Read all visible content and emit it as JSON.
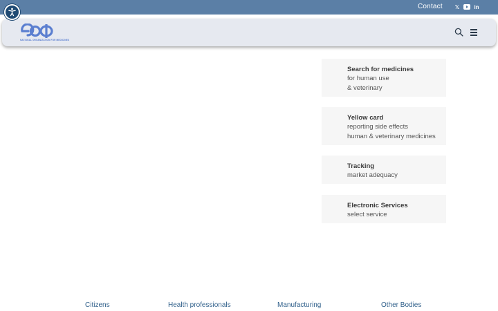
{
  "topbar": {
    "contact_label": "Contact",
    "social": [
      {
        "icon": "x-icon",
        "glyph": "𝕏"
      },
      {
        "icon": "youtube-icon",
        "glyph": "▶"
      },
      {
        "icon": "linkedin-icon",
        "glyph": "in"
      }
    ]
  },
  "accessibility": {
    "icon": "accessibility-icon"
  },
  "header": {
    "logo_text": "EOФ",
    "logo_subtitle": "NATIONAL ORGANIZATION FOR MEDICINES",
    "search_icon": "search-icon",
    "menu_icon": "hamburger-menu-icon"
  },
  "cards": [
    {
      "title": "Search for medicines",
      "lines": [
        "for human use",
        "& veterinary"
      ]
    },
    {
      "title": "Yellow card",
      "lines": [
        "reporting side effects",
        "human & veterinary medicines"
      ]
    },
    {
      "title": "Tracking",
      "lines": [
        "market adequacy"
      ]
    },
    {
      "title": "Electronic Services",
      "lines": [
        "select service"
      ]
    }
  ],
  "footer_nav": [
    "Citizens",
    "Health professionals",
    "Manufacturing",
    "Other Bodies"
  ],
  "colors": {
    "topbar": "#5b7fa6",
    "header_bg": "#e6e9f0",
    "logo_blue": "#5b7fd0",
    "card_bg": "#f6f6f6",
    "link_blue": "#2f5f8a"
  }
}
